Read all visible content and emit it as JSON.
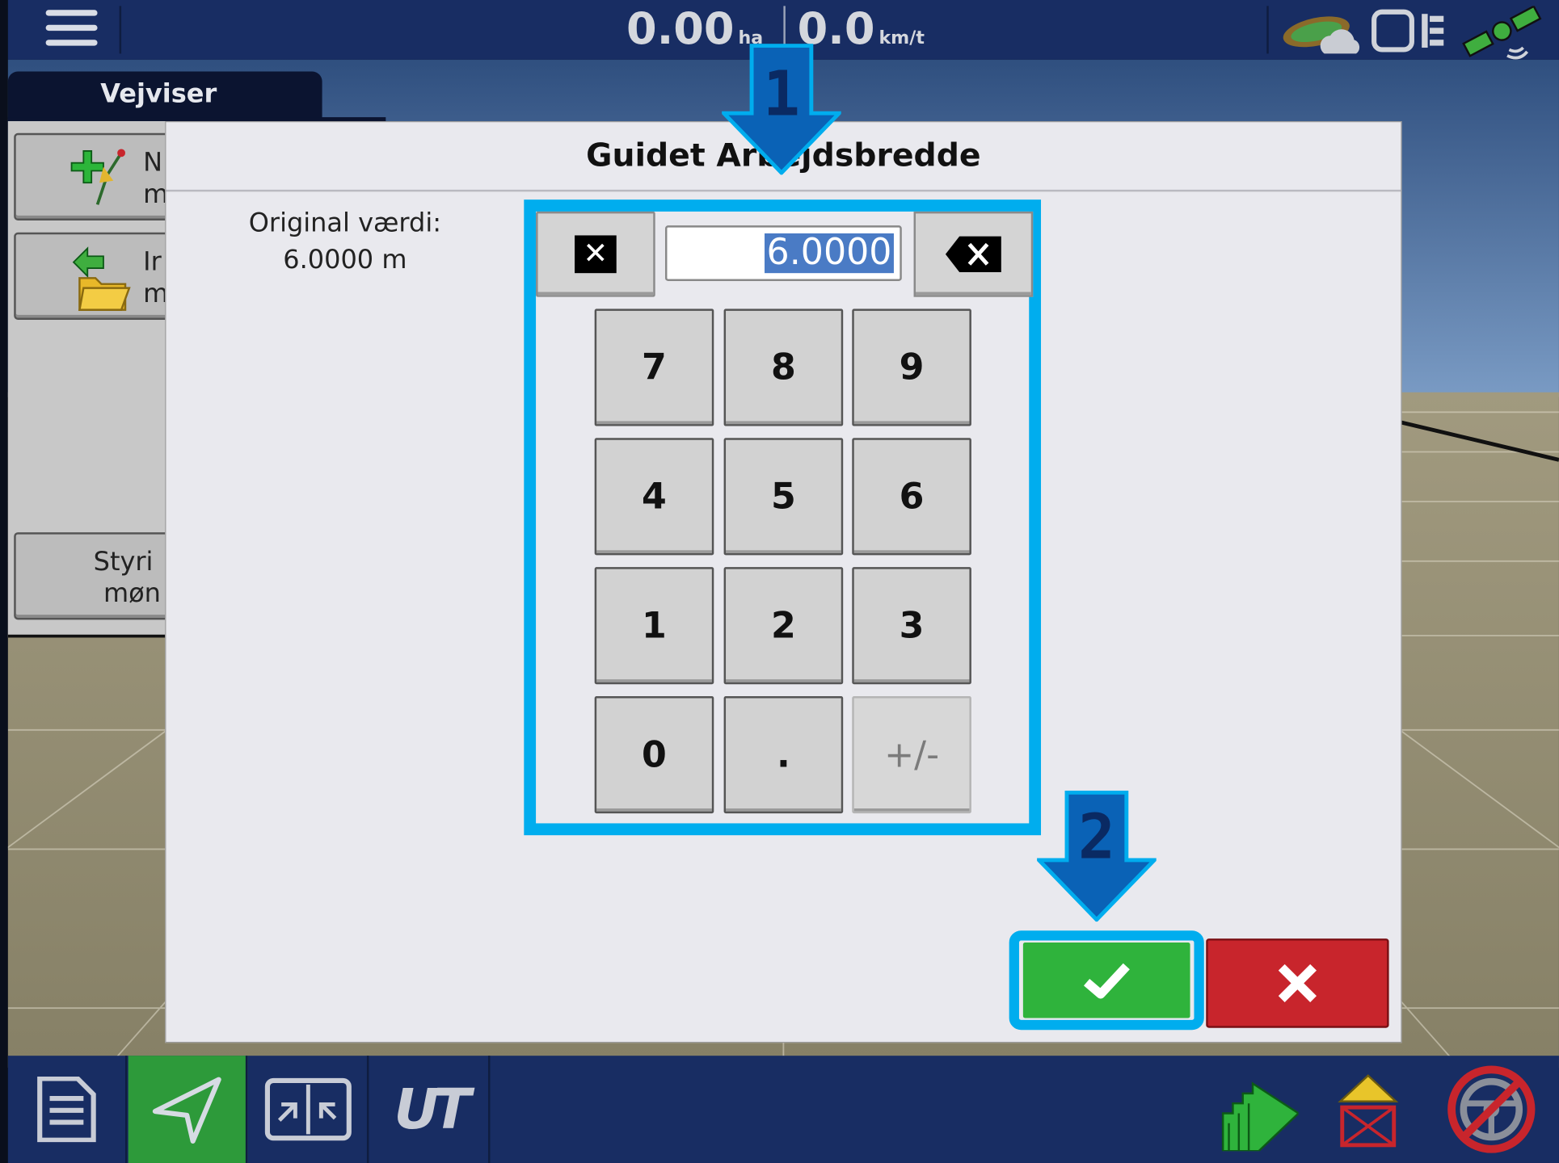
{
  "topbar": {
    "area_value": "0.00",
    "area_unit": "ha",
    "speed_value": "0.0",
    "speed_unit": "km/t"
  },
  "tab": {
    "label": "Vejviser"
  },
  "left_panel": {
    "buttons": [
      {
        "line1": "N",
        "line2": "m"
      },
      {
        "line1": "Ir",
        "line2": "m"
      },
      {
        "line1": "Styri",
        "line2": "møn"
      }
    ]
  },
  "dialog": {
    "title": "Guidet Arbejdsbredde",
    "original_label": "Original værdi:",
    "original_value": "6.0000 m",
    "current_value": "6.0000",
    "keys": [
      "7",
      "8",
      "9",
      "4",
      "5",
      "6",
      "1",
      "2",
      "3",
      "0",
      ".",
      "+/-"
    ]
  },
  "annotations": {
    "step1": "1",
    "step2": "2"
  },
  "colors": {
    "highlight": "#00adee",
    "ok": "#2fb33c",
    "cancel": "#c8252c",
    "bar": "#182d63"
  },
  "icons": {
    "top": [
      "hamburger-menu-icon",
      "field-weather-icon",
      "display-devices-icon",
      "gps-satellite-icon"
    ],
    "bottom": [
      "document-icon",
      "guidance-arrow-icon",
      "split-screen-icon",
      "ut-icon",
      "coverage-map-icon",
      "product-swath-icon",
      "steering-disabled-icon"
    ]
  }
}
